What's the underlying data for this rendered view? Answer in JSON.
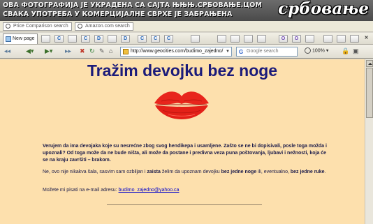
{
  "watermark": {
    "line1": "ОВА ФОТОГРАФИЈА ЈЕ УКРАДЕНА СА САЈТА ЊЊЊ.СРБОВАЊЕ.ЦОМ",
    "line2": "СВАКА УПОТРЕБА У КОМЕРЦИЈАЛНЕ СВРХЕ ЈЕ ЗАБРАЊЕНА",
    "logo": "србовање"
  },
  "searchbar": {
    "price_placeholder": "Price Comparison search",
    "amazon_placeholder": "Amazon.com search"
  },
  "tabs": {
    "new_page_label": "New page",
    "icon_letters": [
      "",
      "C",
      "",
      "C",
      "D",
      "",
      "D",
      "C",
      "C",
      "C",
      "",
      "",
      "O",
      "O",
      ""
    ]
  },
  "navbar": {
    "address": "http://www.geocities.com/budimo_zajedno/",
    "search_placeholder": "Google search",
    "zoom": "100%"
  },
  "page": {
    "headline": "Tražim devojku bez noge",
    "paragraph1": "Verujem da ima devojaka koje su nesrećne zbog svog hendikepa i usamljene. Zašto se ne bi dopisivali, posle toga možda i upoznali? Od toga može da ne bude ništa, ali može da postane i predivna veza puna poštovanja, ljubavi i nežnosti, koja će se na kraju završiti – brakom.",
    "paragraph2_a": "Ne, ovo nije nikakva šala, sasvim sam ozbiljan i ",
    "paragraph2_b": "zaista",
    "paragraph2_c": " želim da upoznam devojku ",
    "paragraph2_d": "bez jedne noge",
    "paragraph2_e": " ili, eventualno, ",
    "paragraph2_f": "bez jedne ruke",
    "paragraph2_g": ".",
    "contact_prefix": "Možete mi pisati na e-mail adresu: ",
    "email": "budimo_zajedno@yahoo.ca"
  },
  "colors": {
    "page_background": "#fde0ad",
    "headline": "#1b1b7a",
    "lips": "#e8251c"
  }
}
